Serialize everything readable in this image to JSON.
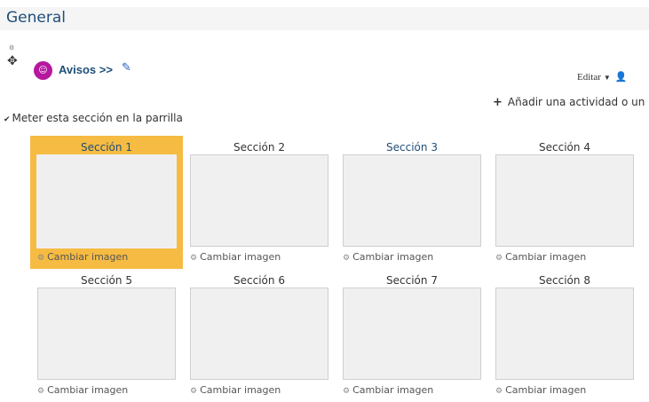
{
  "header": {
    "title": "General"
  },
  "section": {
    "name": "Avisos >>",
    "icon": "group-icon",
    "edit_label": "Editar",
    "add_activity_label": "Añadir una actividad o un recurso",
    "grid_toggle_label": "Meter esta sección en la parrilla"
  },
  "tiles": [
    {
      "title": "Sección 1",
      "change_label": "Cambiar imagen",
      "active": true
    },
    {
      "title": "Sección 2",
      "change_label": "Cambiar imagen",
      "active": false
    },
    {
      "title": "Sección 3",
      "change_label": "Cambiar imagen",
      "active": false
    },
    {
      "title": "Sección 4",
      "change_label": "Cambiar imagen",
      "active": false
    },
    {
      "title": "Sección 5",
      "change_label": "Cambiar imagen",
      "active": false
    },
    {
      "title": "Sección 6",
      "change_label": "Cambiar imagen",
      "active": false
    },
    {
      "title": "Sección 7",
      "change_label": "Cambiar imagen",
      "active": false
    },
    {
      "title": "Sección 8",
      "change_label": "Cambiar imagen",
      "active": false
    }
  ],
  "colors": {
    "active_tile": "#f6bb42",
    "link": "#1f4e79",
    "avisos_icon_bg": "#b5179e"
  }
}
